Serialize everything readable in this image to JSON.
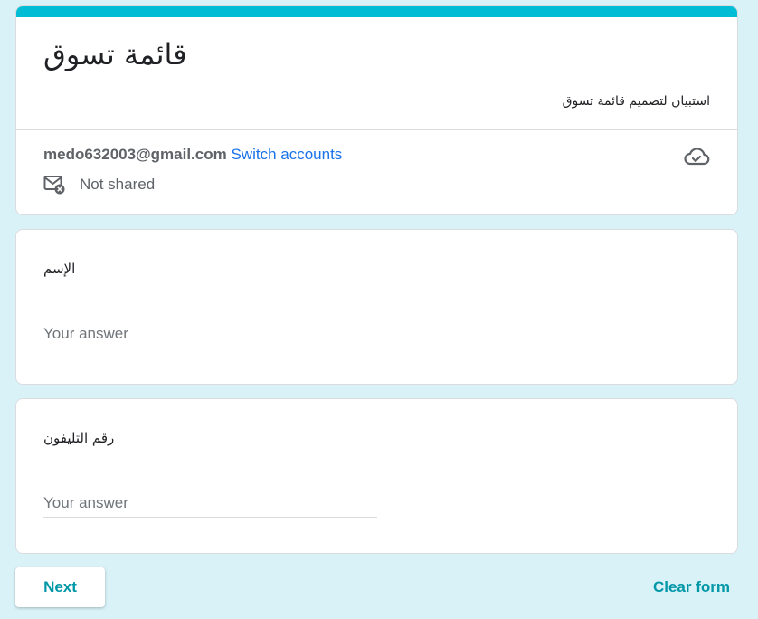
{
  "form": {
    "title": "قائمة تسوق",
    "description": "استبيان لتصميم قائمة تسوق",
    "accent_color": "#00bcd4"
  },
  "account": {
    "email": "medo632003@gmail.com",
    "switch_label": "Switch accounts",
    "share_status": "Not shared",
    "cloud_icon": "cloud-check-icon",
    "mail_icon": "mail-not-shared-icon"
  },
  "questions": [
    {
      "label": "الإسم",
      "placeholder": "Your answer"
    },
    {
      "label": "رقم التليفون",
      "placeholder": "Your answer"
    }
  ],
  "actions": {
    "next_label": "Next",
    "clear_label": "Clear form"
  }
}
